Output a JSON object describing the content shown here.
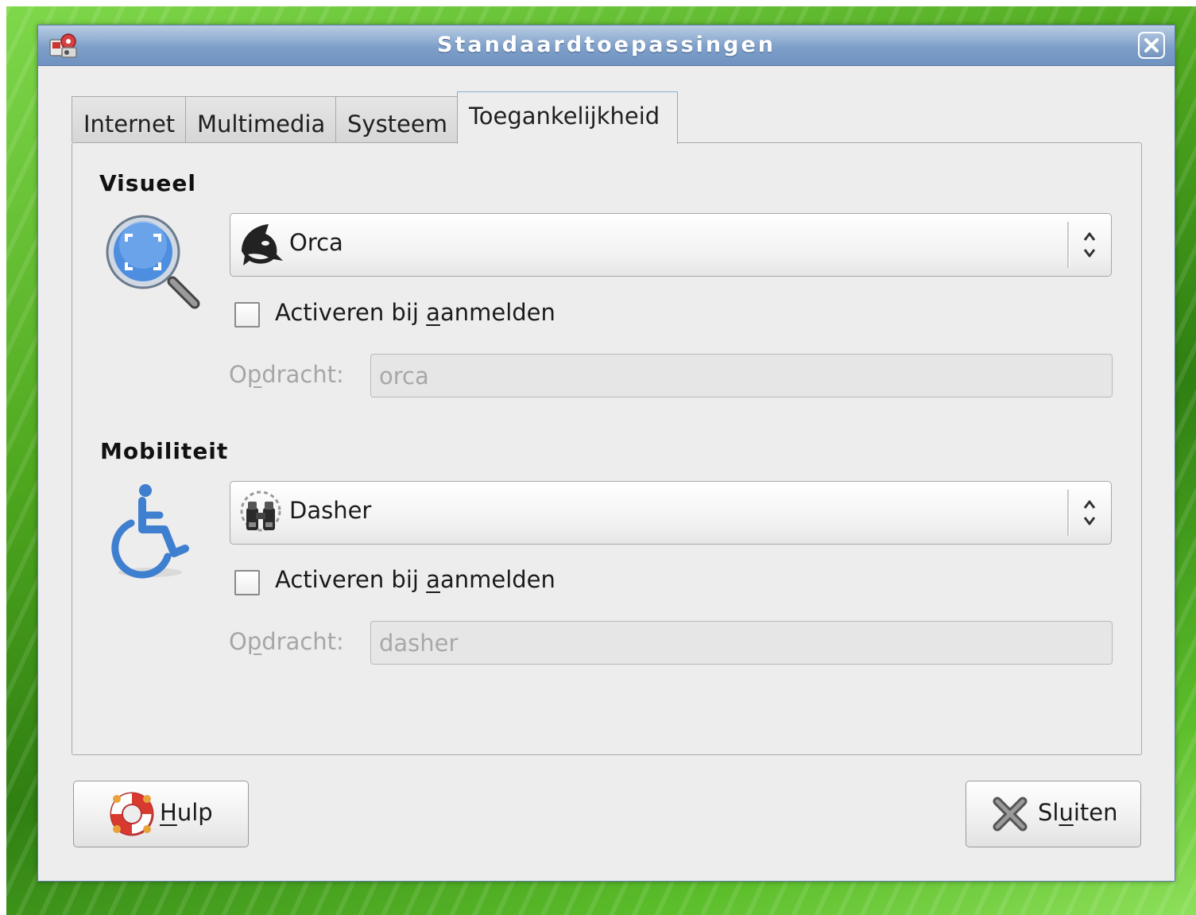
{
  "window": {
    "title": "Standaardtoepassingen"
  },
  "tabs": [
    {
      "label": "Internet",
      "active": false
    },
    {
      "label": "Multimedia",
      "active": false
    },
    {
      "label": "Systeem",
      "active": false
    },
    {
      "label": "Toegankelijkheid",
      "active": true
    }
  ],
  "visual": {
    "title": "Visueel",
    "icon": "magnifier-icon",
    "selected_app": "Orca",
    "app_icon": "orca-whale-icon",
    "autostart_label_pre": "Activeren bij ",
    "autostart_label_mnemonic": "a",
    "autostart_label_post": "anmelden",
    "autostart_checked": false,
    "command_label_pre": "O",
    "command_label_mnemonic": "p",
    "command_label_post": "dracht:",
    "command_value": "orca"
  },
  "mobility": {
    "title": "Mobiliteit",
    "icon": "wheelchair-icon",
    "selected_app": "Dasher",
    "app_icon": "dasher-binoculars-icon",
    "autostart_label_pre": "Activeren bij ",
    "autostart_label_mnemonic": "a",
    "autostart_label_post": "anmelden",
    "autostart_checked": false,
    "command_label_pre": "O",
    "command_label_mnemonic": "p",
    "command_label_post": "dracht:",
    "command_value": "dasher"
  },
  "buttons": {
    "help_mnemonic": "H",
    "help_rest": "ulp",
    "close_pre": "Sl",
    "close_mnemonic": "u",
    "close_post": "iten"
  },
  "colors": {
    "titlebar": "#7e9fc9",
    "accent_blue": "#3f7fd0",
    "window_bg": "#ededed"
  }
}
